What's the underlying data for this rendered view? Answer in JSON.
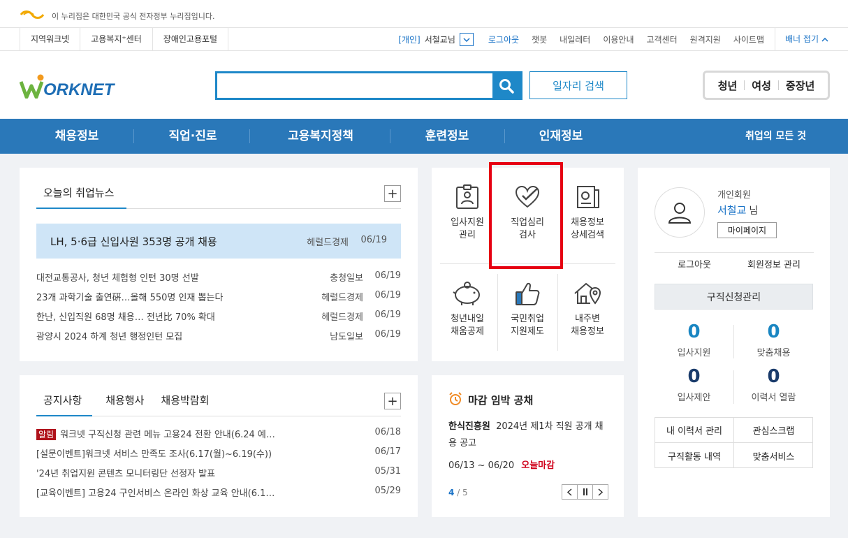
{
  "gov_banner": {
    "text": "이 누리집은 대한민국 공식 전자정부 누리집입니다."
  },
  "util_left": [
    "지역워크넷",
    "고용복지⁺센터",
    "장애인고용포털"
  ],
  "util_right": {
    "member_tag": "[개인]",
    "user_name": "서철교님",
    "links": [
      "로그아웃",
      "챗봇",
      "내일레터",
      "이용안내",
      "고객센터",
      "원격지원",
      "사이트맵"
    ],
    "fold_label": "배너 접기"
  },
  "logo": {
    "text": "WORKNET"
  },
  "search": {
    "placeholder": "",
    "job_search_label": "일자리 검색"
  },
  "age_tabs": [
    "청년",
    "여성",
    "중장년"
  ],
  "gnb": {
    "items": [
      "채용정보",
      "직업·진로",
      "고용복지정책",
      "훈련정보",
      "인재정보"
    ],
    "right": "취업의 모든 것"
  },
  "news": {
    "title": "오늘의 취업뉴스",
    "headline": {
      "title": "LH, 5·6급 신입사원 353명 공개 채용",
      "source": "헤럴드경제",
      "date": "06/19"
    },
    "rows": [
      {
        "title": "대전교통공사, 청년 체험형 인턴 30명 선발",
        "source": "충청일보",
        "date": "06/19"
      },
      {
        "title": "23개 과학기술 출연硏…올해 550명 인재 뽑는다",
        "source": "헤럴드경제",
        "date": "06/19"
      },
      {
        "title": "한난, 신입직원 68명 채용… 전년比 70% 확대",
        "source": "헤럴드경제",
        "date": "06/19"
      },
      {
        "title": "광양시 2024 하계 청년 행정인턴 모집",
        "source": "남도일보",
        "date": "06/19"
      }
    ]
  },
  "notice": {
    "tabs": [
      "공지사항",
      "채용행사",
      "채용박람회"
    ],
    "badge": "알림",
    "rows": [
      {
        "title": "워크넷 구직신청 관련 메뉴 고용24 전환 안내(6.24 예…",
        "date": "06/18"
      },
      {
        "title": "[설문이벤트]워크넷 서비스 만족도 조사(6.17(월)~6.19(수))",
        "date": "06/17"
      },
      {
        "title": "'24년 취업지원 콘텐츠 모니터링단 선정자 발표",
        "date": "05/31"
      },
      {
        "title": "[교육이벤트] 고용24 구인서비스 온라인 화상 교육 안내(6.1…",
        "date": "05/29"
      }
    ]
  },
  "quick_menu": [
    {
      "line1": "입사지원",
      "line2": "관리",
      "icon": "id-card-icon"
    },
    {
      "line1": "직업심리",
      "line2": "검사",
      "icon": "heart-check-icon"
    },
    {
      "line1": "채용정보",
      "line2": "상세검색",
      "icon": "document-search-icon"
    },
    {
      "line1": "청년내일",
      "line2": "채움공제",
      "icon": "piggy-bank-icon"
    },
    {
      "line1": "국민취업",
      "line2": "지원제도",
      "icon": "thumbs-up-icon"
    },
    {
      "line1": "내주변",
      "line2": "채용정보",
      "icon": "house-location-icon"
    }
  ],
  "deadline": {
    "title": "마감 임박 공채",
    "company": "한식진흥원",
    "post": "2024년 제1차 직원 공개 채용 공고",
    "dates": "06/13 ~ 06/20",
    "status": "오늘마감",
    "page_current": "4",
    "page_total": "/ 5"
  },
  "user": {
    "type": "개인회원",
    "name": "서철교",
    "suffix": "님",
    "mypage": "마이페이지",
    "logout": "로그아웃",
    "member_manage": "회원정보 관리",
    "job_mgmt": "구직신청관리",
    "stats": [
      {
        "n": "0",
        "label": "입사지원",
        "color": "#1a86c2"
      },
      {
        "n": "0",
        "label": "맞춤채용",
        "color": "#1a86c2"
      },
      {
        "n": "0",
        "label": "입사제안",
        "color": "#1a3b6b"
      },
      {
        "n": "0",
        "label": "이력서 열람",
        "color": "#1a3b6b"
      }
    ],
    "grid": [
      "내 이력서 관리",
      "관심스크랩",
      "구직활동 내역",
      "맞춤서비스"
    ]
  }
}
